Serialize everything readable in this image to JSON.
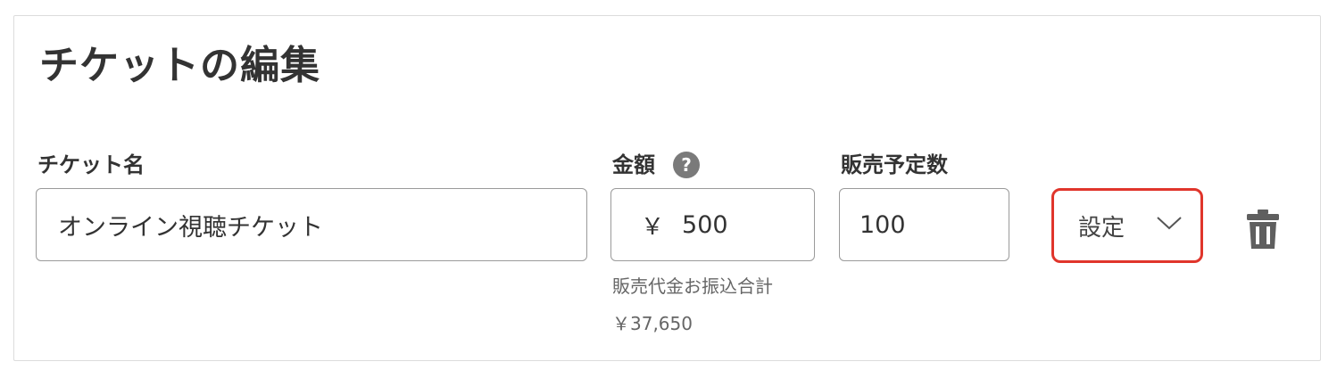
{
  "header": {
    "title": "チケットの編集"
  },
  "ticket_name": {
    "label": "チケット名",
    "value": "オンライン視聴チケット"
  },
  "price": {
    "label": "金額",
    "help_icon": "?",
    "currency_symbol": "￥",
    "value": "500",
    "note_label": "販売代金お振込合計",
    "note_value": "￥37,650"
  },
  "planned_quantity": {
    "label": "販売予定数",
    "value": "100"
  },
  "settings": {
    "label": "設定",
    "icon": "chevron-down-icon",
    "highlight_color": "#e0352b"
  },
  "delete": {
    "icon": "trash-icon"
  }
}
